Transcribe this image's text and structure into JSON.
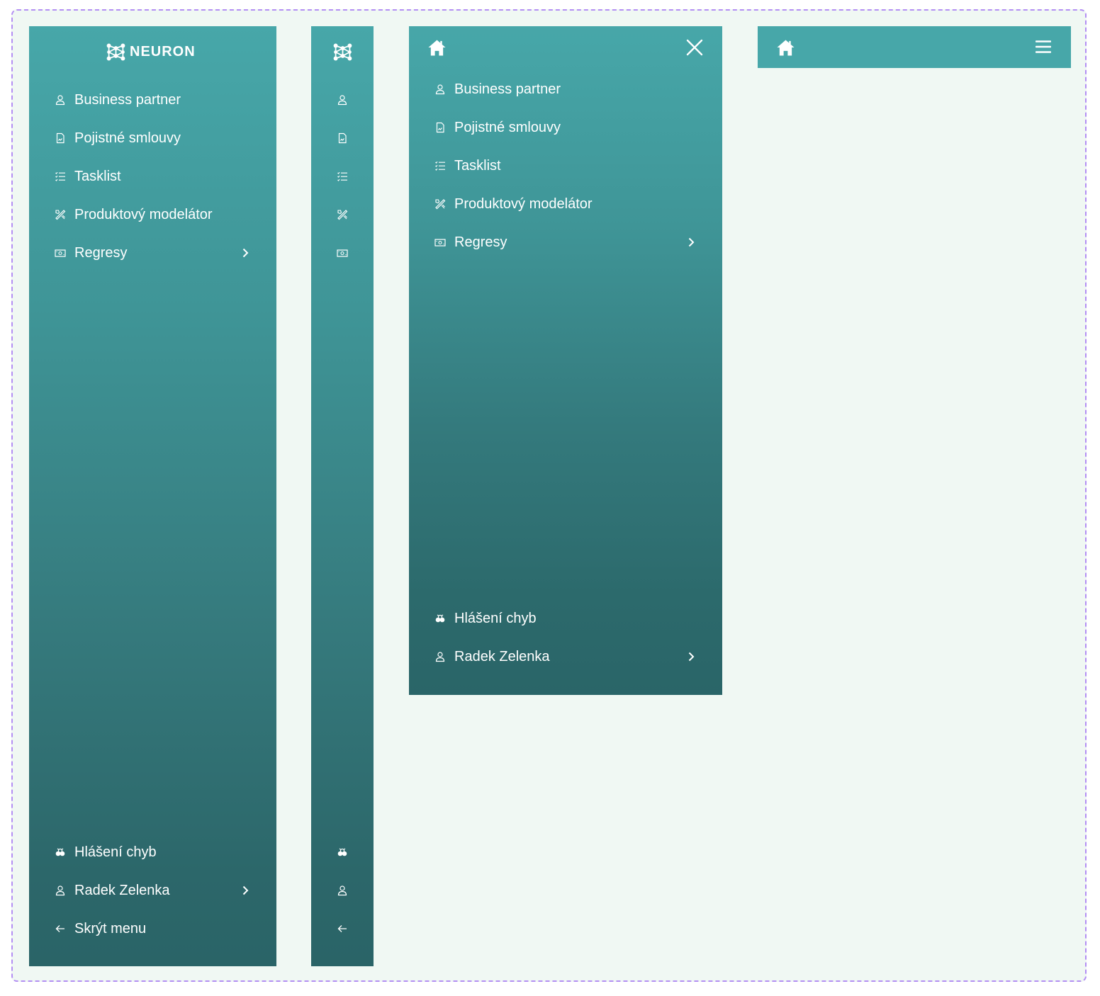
{
  "brand": {
    "name": "NEURON",
    "logo_icon": "neuron-logo-icon"
  },
  "nav": {
    "items": [
      {
        "label": "Business partner",
        "icon": "user-icon"
      },
      {
        "label": "Pojistné smlouvy",
        "icon": "document-icon"
      },
      {
        "label": "Tasklist",
        "icon": "checklist-icon"
      },
      {
        "label": "Produktový modelátor",
        "icon": "tools-icon"
      },
      {
        "label": "Regresy",
        "icon": "money-icon",
        "has_submenu": true
      }
    ]
  },
  "footer": {
    "bug_report": {
      "label": "Hlášení chyb",
      "icon": "bug-icon"
    },
    "user": {
      "label": "Radek Zelenka",
      "icon": "user-icon",
      "has_submenu": true
    },
    "hide_menu": {
      "label": "Skrýt menu",
      "icon": "arrow-left-icon"
    }
  },
  "mobile": {
    "home_icon": "home-icon",
    "close_icon": "close-icon",
    "hamburger_icon": "hamburger-icon"
  },
  "colors": {
    "frame_border": "#b38ef3",
    "canvas": "#f0f8f3",
    "teal_top": "#47a7a9",
    "teal_bottom": "#2a6467",
    "text": "#ffffff"
  }
}
